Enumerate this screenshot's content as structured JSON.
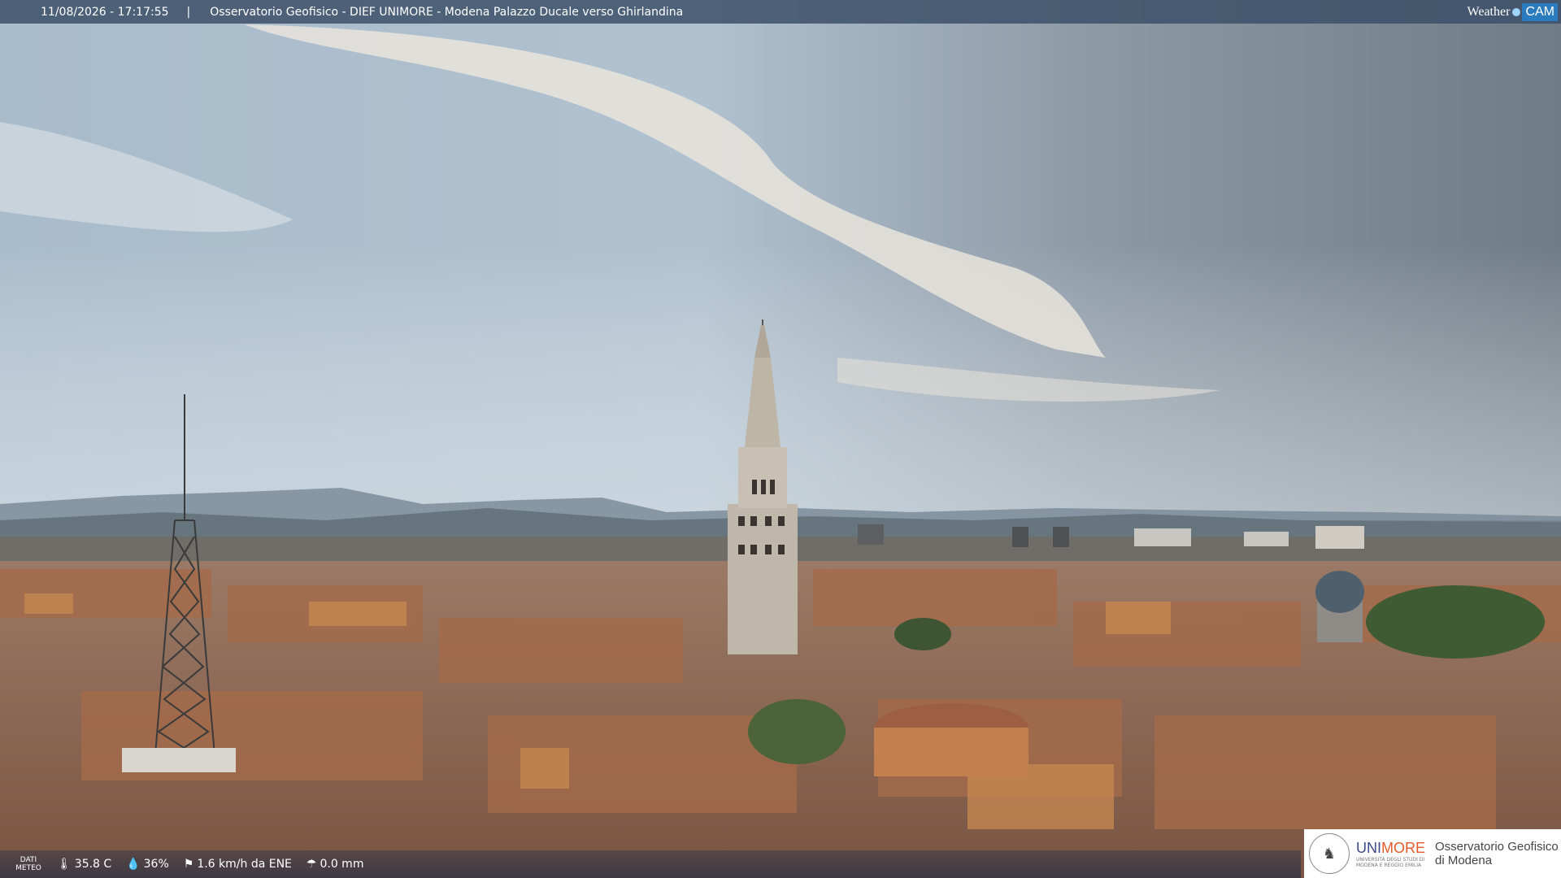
{
  "header": {
    "timestamp": "11/08/2026 - 17:17:55",
    "separator": "|",
    "title": "Osservatorio Geofisico - DIEF UNIMORE - Modena Palazzo Ducale verso Ghirlandina"
  },
  "brand": {
    "weather": "Weather",
    "cam": "CAM"
  },
  "weather": {
    "label_line1": "DATI",
    "label_line2": "METEO",
    "temperature": "35.8 C",
    "humidity": "36%",
    "wind": "1.6 km/h da ENE",
    "rain": "0.0 mm",
    "icons": [
      "thermometer-icon",
      "humidity-icon",
      "wind-icon",
      "rain-icon"
    ]
  },
  "logo": {
    "uni_part1": "UNI",
    "uni_part2": "MORE",
    "uni_small_1": "UNIVERSITÀ DEGLI STUDI DI",
    "uni_small_2": "MODENA E REGGIO EMILIA",
    "obs_line1": "Osservatorio Geofisico",
    "obs_line2": "di Modena"
  },
  "colors": {
    "bar_bg": "#3c5069",
    "uni_blue": "#3b4a8a",
    "uni_orange": "#e35b2a",
    "cam_blue": "#2b7bbf"
  }
}
